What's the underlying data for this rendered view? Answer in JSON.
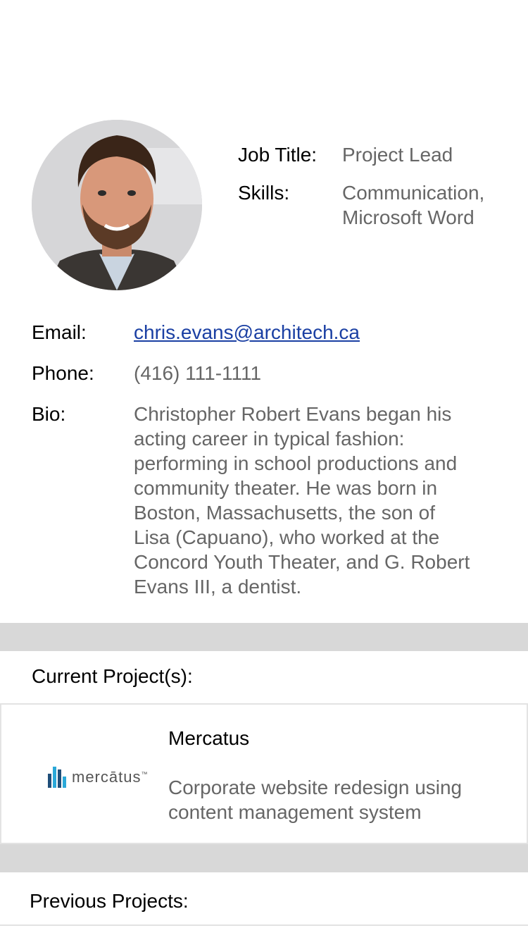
{
  "profile": {
    "job_title_label": "Job Title:",
    "job_title": "Project Lead",
    "skills_label": "Skills:",
    "skills_line1": "Communication,",
    "skills_line2": "Microsoft Word"
  },
  "contact": {
    "email_label": "Email:",
    "email": "chris.evans@architech.ca",
    "phone_label": "Phone:",
    "phone": "(416) 111-1111",
    "bio_label": "Bio:",
    "bio_lines": [
      "Christopher Robert Evans began his",
      "acting career in typical fashion:",
      "performing in school productions and",
      "community theater. He was born in",
      "Boston, Massachusetts, the son of",
      "Lisa (Capuano), who worked at the",
      "Concord Youth Theater, and G. Robert",
      "Evans III, a dentist."
    ]
  },
  "current_projects": {
    "title": "Current Project(s):",
    "items": [
      {
        "name": "Mercatus",
        "logo_text": "mercātus",
        "logo_tm": "™",
        "description": "Corporate website redesign using content management system"
      }
    ]
  },
  "previous_projects": {
    "title": "Previous Projects:"
  },
  "colors": {
    "link": "#1a3fa3",
    "secondary_text": "#666666",
    "band": "#d8d8d8",
    "logo_blue_dark": "#1f4e79",
    "logo_blue_light": "#2aa8d8"
  }
}
